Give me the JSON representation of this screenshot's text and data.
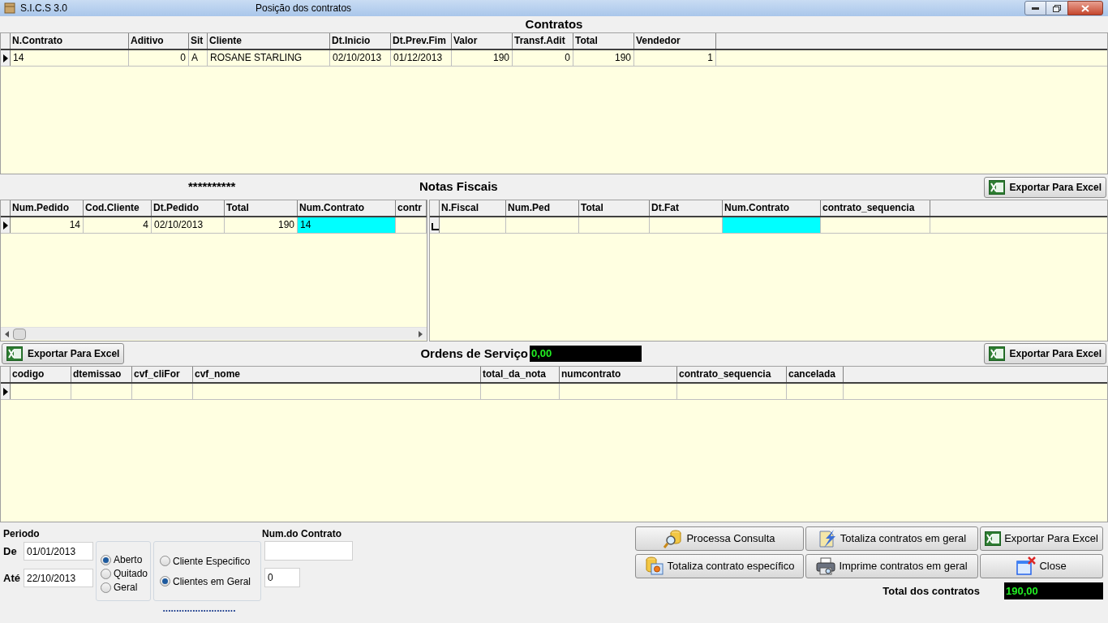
{
  "window": {
    "app_name": "S.I.C.S 3.0",
    "title": "Posição dos contratos"
  },
  "contracts": {
    "title": "Contratos",
    "columns": [
      {
        "label": "N.Contrato"
      },
      {
        "label": "Aditivo"
      },
      {
        "label": "Sit"
      },
      {
        "label": "Cliente"
      },
      {
        "label": "Dt.Inicio"
      },
      {
        "label": "Dt.Prev.Fim"
      },
      {
        "label": "Valor"
      },
      {
        "label": "Transf.Adit"
      },
      {
        "label": "Total"
      },
      {
        "label": "Vendedor"
      }
    ],
    "rows": [
      {
        "kind": "current",
        "cells": [
          "14",
          "0",
          "A",
          "ROSANE STARLING",
          "02/10/2013",
          "01/12/2013",
          "190",
          "0",
          "190",
          "1"
        ]
      }
    ]
  },
  "orders_caption": "**********",
  "orders": {
    "columns": [
      {
        "label": "Num.Pedido",
        "selected": false
      },
      {
        "label": "Cod.Cliente",
        "selected": false
      },
      {
        "label": "Dt.Pedido",
        "selected": false
      },
      {
        "label": "Total",
        "selected": false
      },
      {
        "label": "Num.Contrato",
        "selected": true
      },
      {
        "label": "contr",
        "selected": false
      }
    ],
    "rows": [
      {
        "kind": "current",
        "cells": [
          "14",
          "4",
          "02/10/2013",
          "190",
          "14"
        ]
      }
    ]
  },
  "invoices": {
    "title": "Notas Fiscais",
    "export_button": "Exportar Para Excel",
    "columns": [
      {
        "label": "N.Fiscal",
        "selected": false
      },
      {
        "label": "Num.Ped",
        "selected": false
      },
      {
        "label": "Total",
        "selected": false
      },
      {
        "label": "Dt.Fat",
        "selected": false
      },
      {
        "label": "Num.Contrato",
        "selected": true
      },
      {
        "label": "contrato_sequencia",
        "selected": false
      }
    ],
    "rows": [
      {
        "kind": "new"
      }
    ]
  },
  "service_orders": {
    "export_left": "Exportar Para Excel",
    "title": "Ordens de Serviço",
    "total": "0,00",
    "export_right": "Exportar Para Excel",
    "columns": [
      {
        "label": "codigo"
      },
      {
        "label": "dtemissao"
      },
      {
        "label": "cvf_cliFor"
      },
      {
        "label": "cvf_nome"
      },
      {
        "label": "total_da_nota"
      },
      {
        "label": "numcontrato"
      },
      {
        "label": "contrato_sequencia"
      },
      {
        "label": "cancelada"
      }
    ],
    "rows": [
      {
        "kind": "current"
      }
    ]
  },
  "filters": {
    "period_label": "Periodo",
    "from": {
      "label": "De",
      "value": "01/01/2013"
    },
    "to": {
      "label": "Até",
      "value": "22/10/2013"
    },
    "status_options": [
      {
        "label": "Aberto",
        "selected": true
      },
      {
        "label": "Quitado",
        "selected": false
      },
      {
        "label": "Geral",
        "selected": false
      }
    ],
    "client_options": [
      {
        "label": "Cliente Especifico",
        "selected": false
      },
      {
        "label": "Clientes em Geral",
        "selected": true
      }
    ],
    "dots": "...........................",
    "contract_number": {
      "label": "Num.do Contrato"
    },
    "number_field": {
      "value": "0"
    }
  },
  "actions": [
    {
      "label": "Processa Consulta",
      "kind": "query"
    },
    {
      "label": "Totaliza contratos em geral",
      "kind": "totalize"
    },
    {
      "label": "Exportar Para Excel",
      "kind": "excel"
    },
    {
      "label": "Totaliza contrato específico",
      "kind": "totalize_one"
    },
    {
      "label": "Imprime contratos em geral",
      "kind": "print"
    },
    {
      "label": "Close",
      "kind": "close"
    }
  ],
  "total": {
    "label": "Total dos contratos",
    "value": "190,00"
  }
}
